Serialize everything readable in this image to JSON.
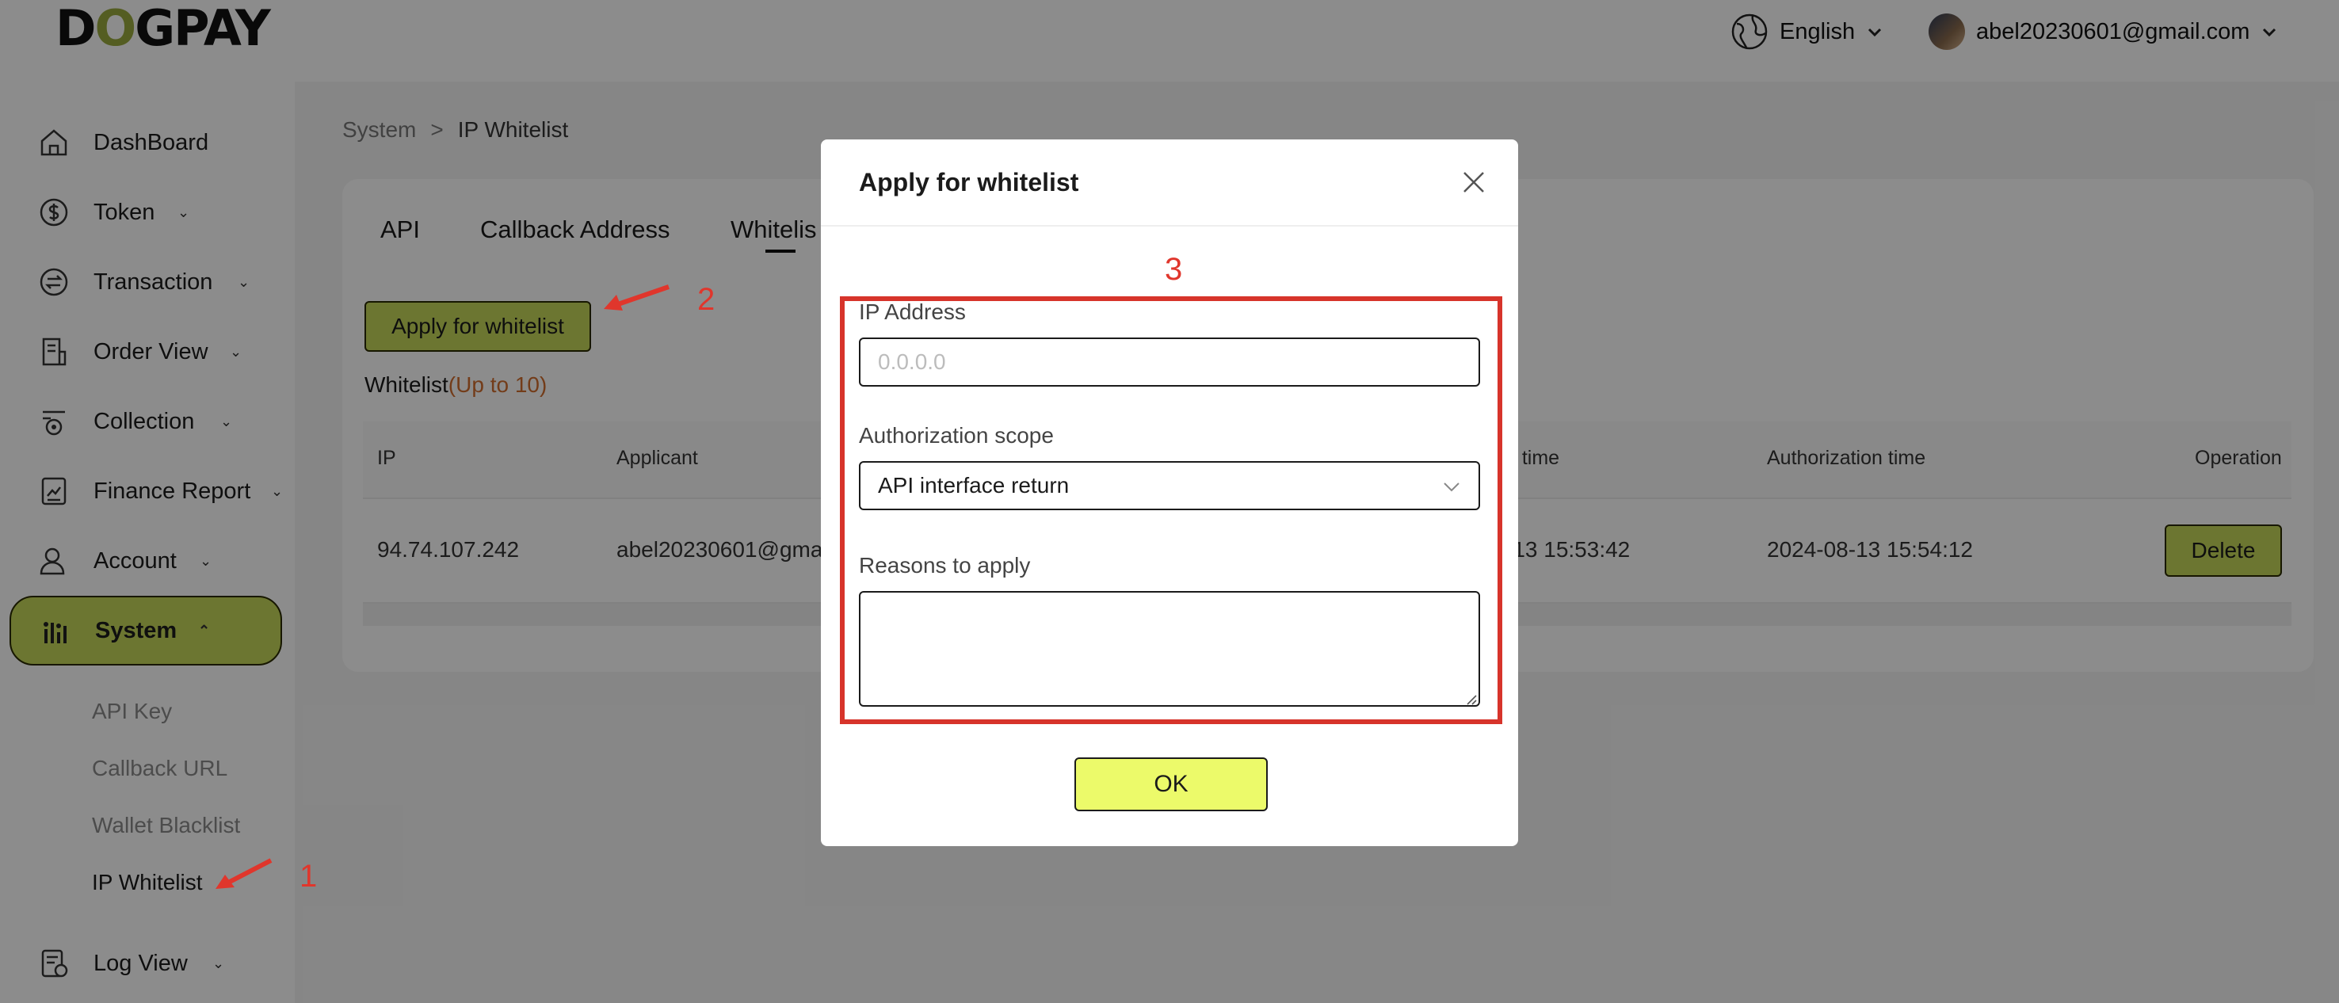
{
  "header": {
    "logo": "DOGPAY",
    "language": "English",
    "user_email": "abel20230601@gmail.com"
  },
  "sidebar": {
    "items": [
      {
        "label": "DashBoard",
        "icon": "home-icon"
      },
      {
        "label": "Token",
        "icon": "dollar-icon"
      },
      {
        "label": "Transaction",
        "icon": "exchange-icon"
      },
      {
        "label": "Order View",
        "icon": "order-icon"
      },
      {
        "label": "Collection",
        "icon": "collection-icon"
      },
      {
        "label": "Finance Report",
        "icon": "report-icon"
      },
      {
        "label": "Account",
        "icon": "user-icon"
      },
      {
        "label": "System",
        "icon": "bar-chart-icon"
      },
      {
        "label": "Log View",
        "icon": "log-icon"
      }
    ],
    "system_sub": [
      "API Key",
      "Callback URL",
      "Wallet Blacklist",
      "IP Whitelist"
    ]
  },
  "breadcrumb": {
    "root": "System",
    "sep": ">",
    "current": "IP Whitelist"
  },
  "tabs": [
    "API",
    "Callback Address",
    "Whitelis"
  ],
  "apply_button": "Apply for whitelist",
  "whitelist_label": {
    "text": "Whitelist",
    "limit": "(Up to 10)"
  },
  "table": {
    "headers": [
      "IP",
      "Applicant",
      "n time",
      "Authorization time",
      "Operation"
    ],
    "rows": [
      {
        "ip": "94.74.107.242",
        "applicant": "abel20230601@gma",
        "application_time": "-13 15:53:42",
        "authorization_time": "2024-08-13 15:54:12",
        "operation": "Delete"
      }
    ]
  },
  "annotations": {
    "n1": "1",
    "n2": "2",
    "n3": "3"
  },
  "modal": {
    "title": "Apply for whitelist",
    "ip_label": "IP Address",
    "ip_placeholder": "0.0.0.0",
    "scope_label": "Authorization scope",
    "scope_value": "API interface return",
    "reason_label": "Reasons to apply",
    "ok": "OK"
  },
  "colors": {
    "accent": "#c5d85a",
    "ok_button": "#ecfa6a",
    "annotation_red": "#d7342b",
    "limit_orange": "#d26e2e"
  }
}
